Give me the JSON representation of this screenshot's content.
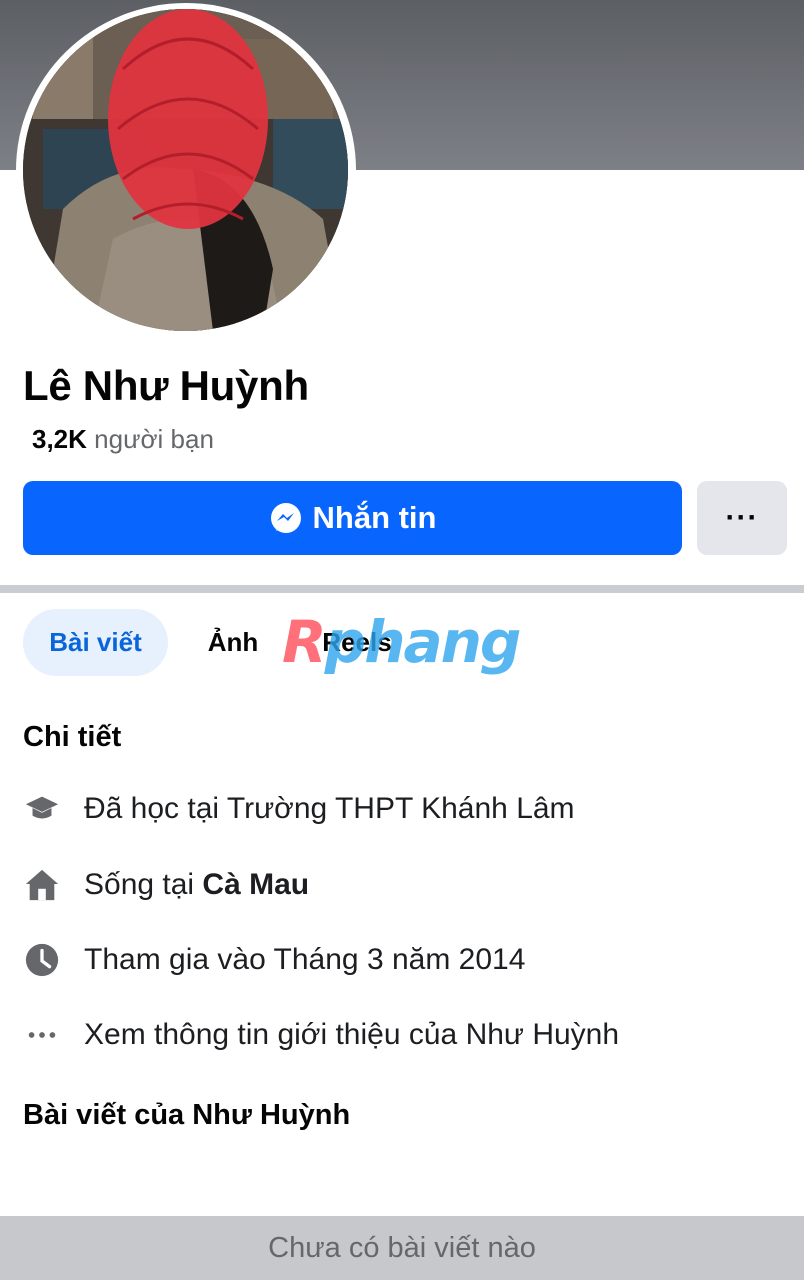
{
  "profile": {
    "name": "Lê Như Huỳnh",
    "friends_count": "3,2K",
    "friends_label": "người bạn"
  },
  "actions": {
    "message_label": "Nhắn tin",
    "message_icon": "messenger-icon",
    "more_label": "···"
  },
  "tabs": [
    {
      "label": "Bài viết",
      "active": true
    },
    {
      "label": "Ảnh",
      "active": false
    },
    {
      "label": "Reels",
      "active": false
    }
  ],
  "watermark": {
    "first": "R",
    "rest": "phang"
  },
  "details": {
    "title": "Chi tiết",
    "items": [
      {
        "icon": "graduation-cap-icon",
        "text": "Đã học tại Trường THPT Khánh Lâm"
      },
      {
        "icon": "home-icon",
        "prefix": "Sống tại ",
        "bold": "Cà Mau"
      },
      {
        "icon": "clock-icon",
        "text": "Tham gia vào Tháng 3 năm 2014"
      },
      {
        "icon": "more-dots-icon",
        "text": "Xem thông tin giới thiệu của Như Huỳnh"
      }
    ]
  },
  "posts": {
    "title": "Bài viết của Như Huỳnh",
    "empty_label": "Chưa có bài viết nào"
  },
  "colors": {
    "accent": "#0866ff",
    "tab_active_bg": "#e7f0fd",
    "tab_active_text": "#0a66d8",
    "muted_text": "#65676b",
    "icon_gray": "#65676b"
  }
}
